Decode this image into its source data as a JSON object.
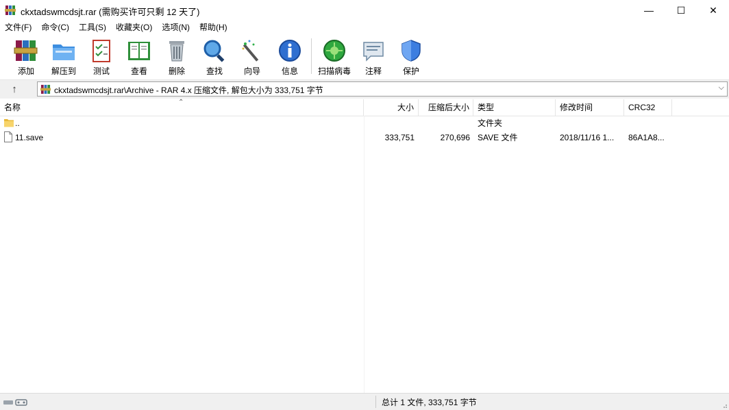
{
  "window": {
    "title": "ckxtadswmcdsjt.rar (需购买许可只剩 12 天了)",
    "minimize": "—",
    "maximize": "☐",
    "close": "✕"
  },
  "menu": [
    {
      "label": "文件(F)"
    },
    {
      "label": "命令(C)"
    },
    {
      "label": "工具(S)"
    },
    {
      "label": "收藏夹(O)"
    },
    {
      "label": "选项(N)"
    },
    {
      "label": "帮助(H)"
    }
  ],
  "toolbar": {
    "add": "添加",
    "extract": "解压到",
    "test": "测试",
    "view": "查看",
    "delete": "删除",
    "find": "查找",
    "wizard": "向导",
    "info": "信息",
    "scan": "扫描病毒",
    "comment": "注释",
    "protect": "保护"
  },
  "address": {
    "up": "↑",
    "path": "ckxtadswmcdsjt.rar\\Archive - RAR 4.x 压缩文件, 解包大小为 333,751 字节",
    "dropdown": "⌵"
  },
  "columns": {
    "name": "名称",
    "size": "大小",
    "packed": "压缩后大小",
    "type": "类型",
    "modified": "修改时间",
    "crc": "CRC32",
    "sort_arrow": "⌃"
  },
  "rows": [
    {
      "name": "..",
      "size": "",
      "packed": "",
      "type": "文件夹",
      "modified": "",
      "crc": "",
      "icon": "folder-icon"
    },
    {
      "name": "11.save",
      "size": "333,751",
      "packed": "270,696",
      "type": "SAVE 文件",
      "modified": "2018/11/16 1...",
      "crc": "86A1A8...",
      "icon": "file-icon"
    }
  ],
  "status": {
    "summary": "总计 1 文件, 333,751 字节"
  }
}
